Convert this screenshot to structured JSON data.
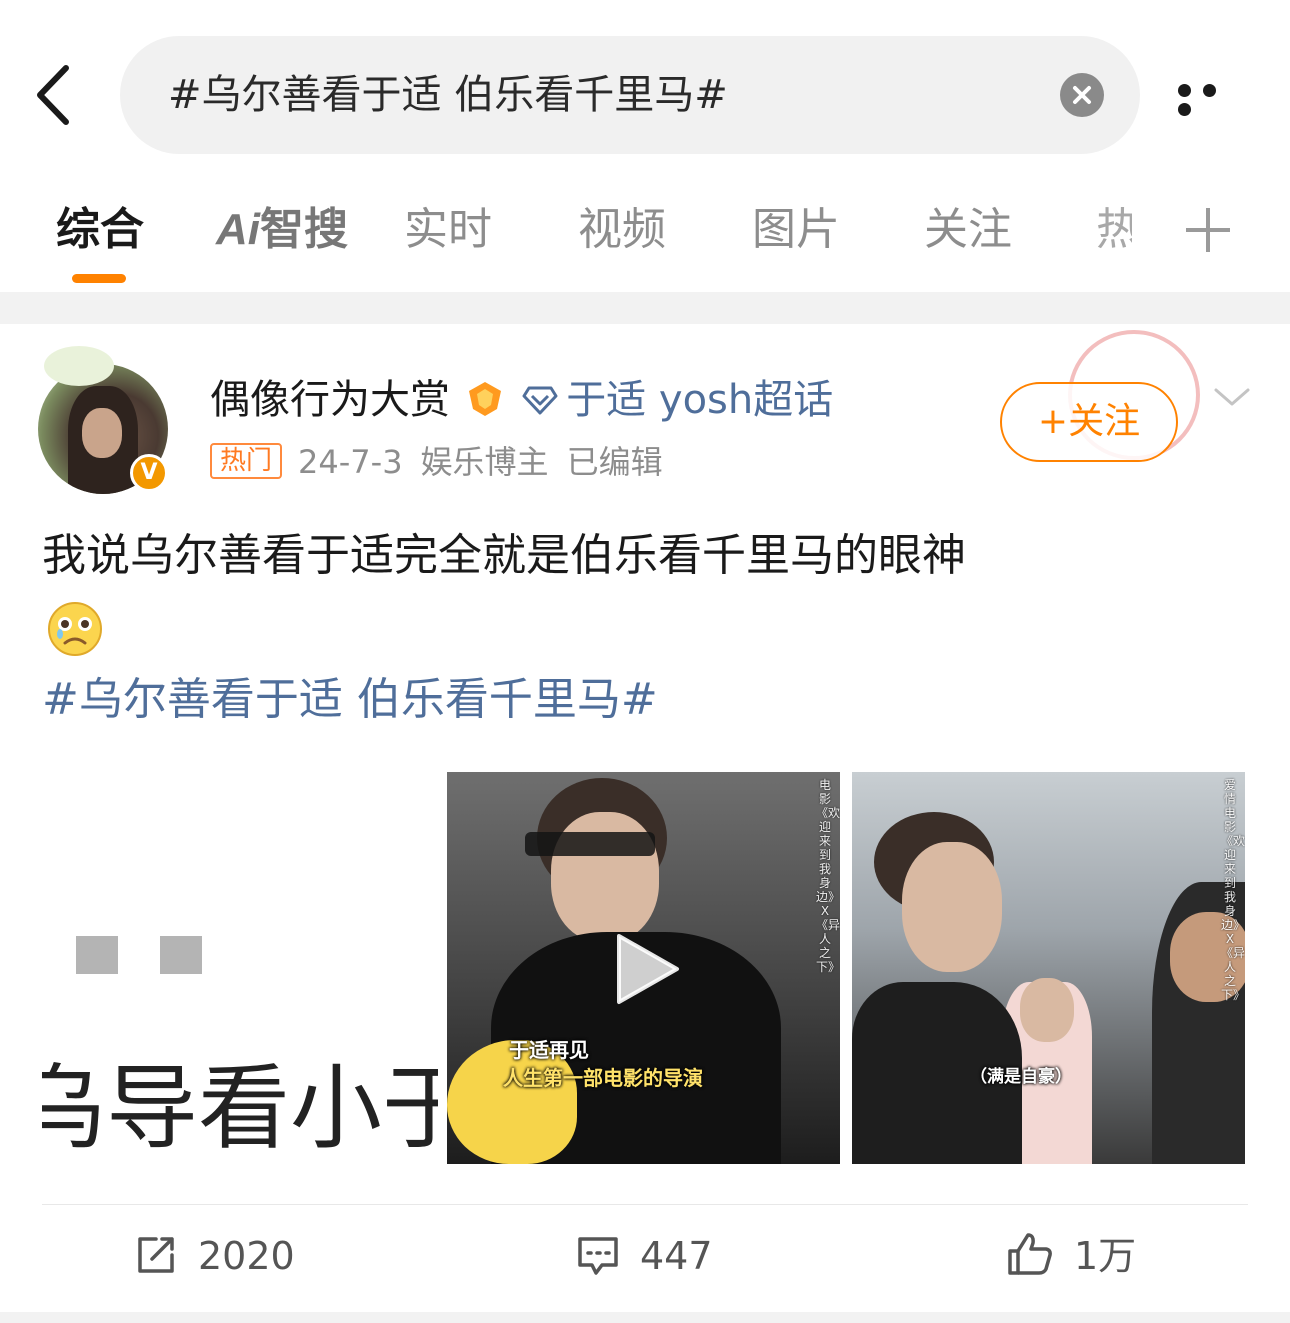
{
  "search": {
    "query": "#乌尔善看于适 伯乐看千里马#"
  },
  "tabs": [
    {
      "label": "综合",
      "active": true
    },
    {
      "label": "Ai智搜",
      "ai_prefix": "Ai",
      "ai_rest": "智搜"
    },
    {
      "label": "实时"
    },
    {
      "label": "视频"
    },
    {
      "label": "图片"
    },
    {
      "label": "关注"
    },
    {
      "label": "热"
    }
  ],
  "post": {
    "author": "偶像行为大赏",
    "supertopic": "于适 yosh超话",
    "hot_badge": "热门",
    "date": "24-7-3",
    "author_type": "娱乐博主",
    "edited": "已编辑",
    "follow_label": "+关注",
    "text": "我说乌尔善看于适完全就是伯乐看千里马的眼神",
    "hashtag": "#乌尔善看于适 伯乐看千里马#",
    "images": [
      {
        "caption": "乌导看小于"
      },
      {
        "caption_line1": "于适再见",
        "caption_line2": "人生第一部电影的导演",
        "side_text": "电影《欢迎来到我身边》X《异人之下》"
      },
      {
        "caption": "（满是自豪）",
        "side_text": "爱情电影《欢迎来到我身边》X《异人之下》"
      }
    ],
    "reposts": "2020",
    "comments": "447",
    "likes": "1万"
  },
  "colors": {
    "accent": "#ff8200",
    "link": "#4f6e9a",
    "muted": "#8d8d8d"
  },
  "icons": [
    "back-chevron-icon",
    "clear-icon",
    "more-icon",
    "plus-icon",
    "medal-icon",
    "diamond-icon",
    "chevron-down-icon",
    "play-icon",
    "repost-icon",
    "comment-icon",
    "like-icon"
  ]
}
